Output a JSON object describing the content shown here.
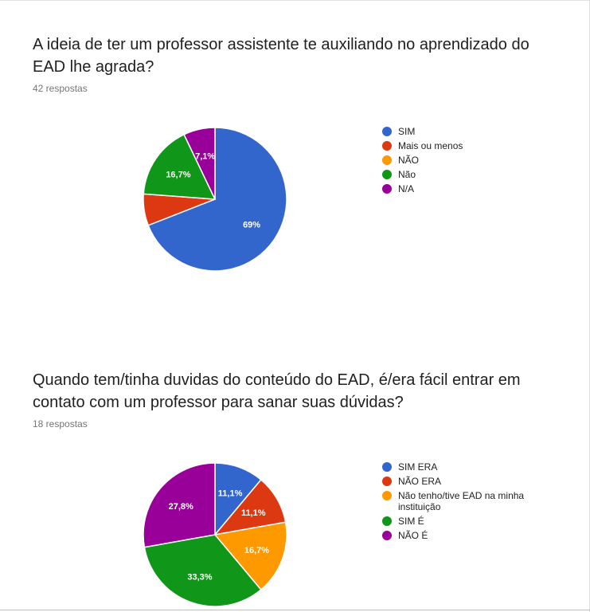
{
  "charts": [
    {
      "question": "A ideia de ter um professor assistente te auxiliando no aprendizado do EAD lhe agrada?",
      "responses": "42 respostas"
    },
    {
      "question": "Quando tem/tinha duvidas do conteúdo do EAD, é/era fácil entrar em contato com um professor para sanar suas dúvidas?",
      "responses": "18 respostas"
    }
  ],
  "chart_data": [
    {
      "type": "pie",
      "title": "A ideia de ter um professor assistente te auxiliando no aprendizado do EAD lhe agrada?",
      "legend_position": "right",
      "slices": [
        {
          "label": "SIM",
          "value": 69.0,
          "display": "69%",
          "color": "#3366cc"
        },
        {
          "label": "Mais ou menos",
          "value": 7.1,
          "display": "",
          "color": "#dc3912"
        },
        {
          "label": "NÃO",
          "value": 0.0,
          "display": "",
          "color": "#ff9900"
        },
        {
          "label": "Não",
          "value": 16.7,
          "display": "16,7%",
          "color": "#109618"
        },
        {
          "label": "N/A",
          "value": 7.1,
          "display": "7,1%",
          "color": "#990099"
        }
      ]
    },
    {
      "type": "pie",
      "title": "Quando tem/tinha duvidas do conteúdo do EAD, é/era fácil entrar em contato com um professor para sanar suas dúvidas?",
      "legend_position": "right",
      "slices": [
        {
          "label": "SIM ERA",
          "value": 11.1,
          "display": "11,1%",
          "color": "#3366cc"
        },
        {
          "label": "NÃO ERA",
          "value": 11.1,
          "display": "11,1%",
          "color": "#dc3912"
        },
        {
          "label": "Não tenho/tive EAD na minha instituição",
          "value": 16.7,
          "display": "16,7%",
          "color": "#ff9900"
        },
        {
          "label": "SIM É",
          "value": 33.3,
          "display": "33,3%",
          "color": "#109618"
        },
        {
          "label": "NÃO É",
          "value": 27.8,
          "display": "27,8%",
          "color": "#990099"
        }
      ]
    }
  ]
}
